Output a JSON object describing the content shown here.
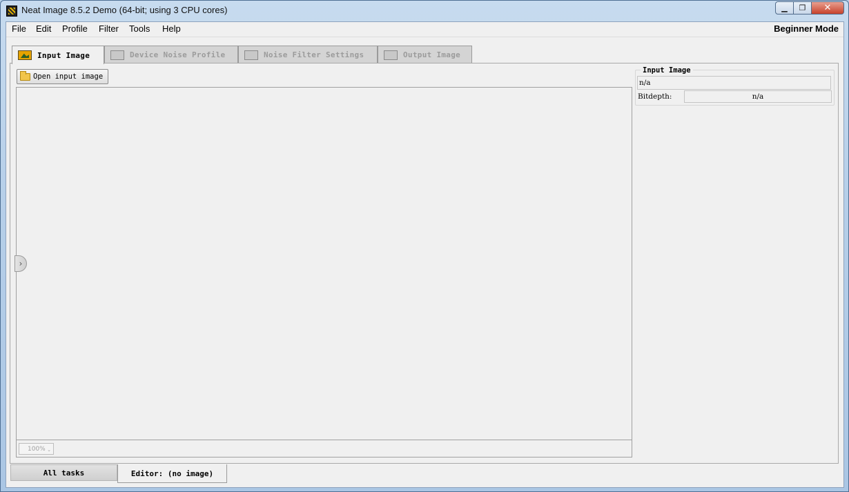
{
  "window": {
    "title": "Neat Image 8.5.2 Demo (64-bit; using 3 CPU cores)"
  },
  "menu": {
    "items": [
      "File",
      "Edit",
      "Profile",
      "Filter",
      "Tools",
      "Help"
    ],
    "mode": "Beginner Mode"
  },
  "tabs": [
    {
      "label": "Input Image",
      "icon": "picture-icon",
      "active": true
    },
    {
      "label": "Device Noise Profile",
      "icon": "profile-icon",
      "active": false
    },
    {
      "label": "Noise Filter Settings",
      "icon": "sliders-icon",
      "active": false
    },
    {
      "label": "Output Image",
      "icon": "output-image-icon",
      "active": false
    }
  ],
  "input_panel": {
    "open_button": "Open input image",
    "zoom": "100%"
  },
  "info": {
    "group_title": "Input Image",
    "filename": "n/a",
    "bitdepth_label": "Bitdepth:",
    "bitdepth_value": "n/a"
  },
  "bottom_tabs": {
    "all_tasks": "All tasks",
    "editor": "Editor: (no image)"
  },
  "colors": {
    "titlebar": "#b6cfe9",
    "close_button": "#c7422b",
    "panel_bg": "#f0f0f0"
  }
}
